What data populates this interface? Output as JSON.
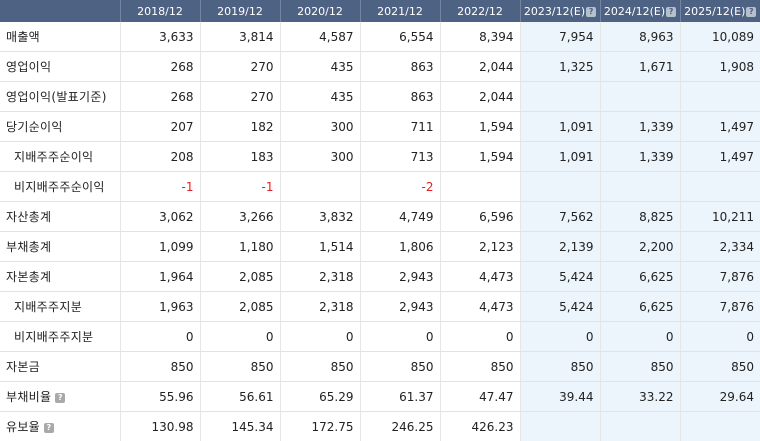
{
  "columns": [
    "2018/12",
    "2019/12",
    "2020/12",
    "2021/12",
    "2022/12",
    "2023/12(E)",
    "2024/12(E)",
    "2025/12(E)"
  ],
  "estimate_columns_from_index": 5,
  "help_icon_glyph": "?",
  "colors": {
    "header_bg": "#4e6283",
    "estimate_bg": "#ebf5fb",
    "negative": "#e02020"
  },
  "rows": [
    {
      "label": "매출액",
      "indent": false,
      "help": false,
      "values": [
        "3,633",
        "3,814",
        "4,587",
        "6,554",
        "8,394",
        "7,954",
        "8,963",
        "10,089"
      ]
    },
    {
      "label": "영업이익",
      "indent": false,
      "help": false,
      "values": [
        "268",
        "270",
        "435",
        "863",
        "2,044",
        "1,325",
        "1,671",
        "1,908"
      ]
    },
    {
      "label": "영업이익(발표기준)",
      "indent": false,
      "help": false,
      "values": [
        "268",
        "270",
        "435",
        "863",
        "2,044",
        "",
        "",
        ""
      ]
    },
    {
      "label": "당기순이익",
      "indent": false,
      "help": false,
      "values": [
        "207",
        "182",
        "300",
        "711",
        "1,594",
        "1,091",
        "1,339",
        "1,497"
      ]
    },
    {
      "label": "지배주주순이익",
      "indent": true,
      "help": false,
      "values": [
        "208",
        "183",
        "300",
        "713",
        "1,594",
        "1,091",
        "1,339",
        "1,497"
      ]
    },
    {
      "label": "비지배주주순이익",
      "indent": true,
      "help": false,
      "values": [
        "-1",
        "-1",
        "",
        "-2",
        "",
        "",
        "",
        ""
      ]
    },
    {
      "label": "자산총계",
      "indent": false,
      "help": false,
      "values": [
        "3,062",
        "3,266",
        "3,832",
        "4,749",
        "6,596",
        "7,562",
        "8,825",
        "10,211"
      ]
    },
    {
      "label": "부채총계",
      "indent": false,
      "help": false,
      "values": [
        "1,099",
        "1,180",
        "1,514",
        "1,806",
        "2,123",
        "2,139",
        "2,200",
        "2,334"
      ]
    },
    {
      "label": "자본총계",
      "indent": false,
      "help": false,
      "values": [
        "1,964",
        "2,085",
        "2,318",
        "2,943",
        "4,473",
        "5,424",
        "6,625",
        "7,876"
      ]
    },
    {
      "label": "지배주주지분",
      "indent": true,
      "help": false,
      "values": [
        "1,963",
        "2,085",
        "2,318",
        "2,943",
        "4,473",
        "5,424",
        "6,625",
        "7,876"
      ]
    },
    {
      "label": "비지배주주지분",
      "indent": true,
      "help": false,
      "values": [
        "0",
        "0",
        "0",
        "0",
        "0",
        "0",
        "0",
        "0"
      ]
    },
    {
      "label": "자본금",
      "indent": false,
      "help": false,
      "values": [
        "850",
        "850",
        "850",
        "850",
        "850",
        "850",
        "850",
        "850"
      ]
    },
    {
      "label": "부채비율",
      "indent": false,
      "help": true,
      "values": [
        "55.96",
        "56.61",
        "65.29",
        "61.37",
        "47.47",
        "39.44",
        "33.22",
        "29.64"
      ]
    },
    {
      "label": "유보율",
      "indent": false,
      "help": true,
      "values": [
        "130.98",
        "145.34",
        "172.75",
        "246.25",
        "426.23",
        "",
        "",
        ""
      ]
    }
  ]
}
